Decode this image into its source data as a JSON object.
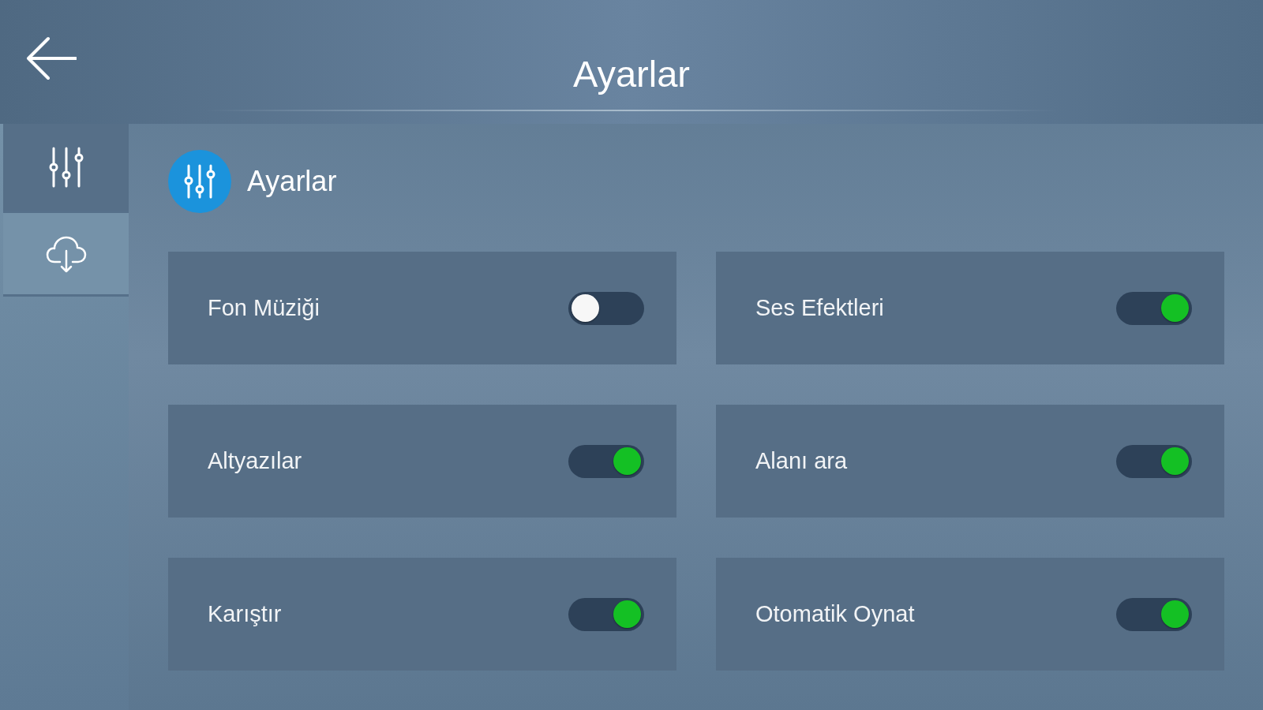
{
  "header": {
    "title": "Ayarlar"
  },
  "sidebar": {
    "items": [
      {
        "kind": "sliders",
        "selected": true
      },
      {
        "kind": "cloud",
        "selected": false
      }
    ]
  },
  "section": {
    "title": "Ayarlar"
  },
  "settings": [
    {
      "label": "Fon Müziği",
      "on": false
    },
    {
      "label": "Ses Efektleri",
      "on": true
    },
    {
      "label": "Altyazılar",
      "on": true
    },
    {
      "label": "Alanı ara",
      "on": true
    },
    {
      "label": "Karıştır",
      "on": true
    },
    {
      "label": "Otomatik Oynat",
      "on": true
    }
  ]
}
